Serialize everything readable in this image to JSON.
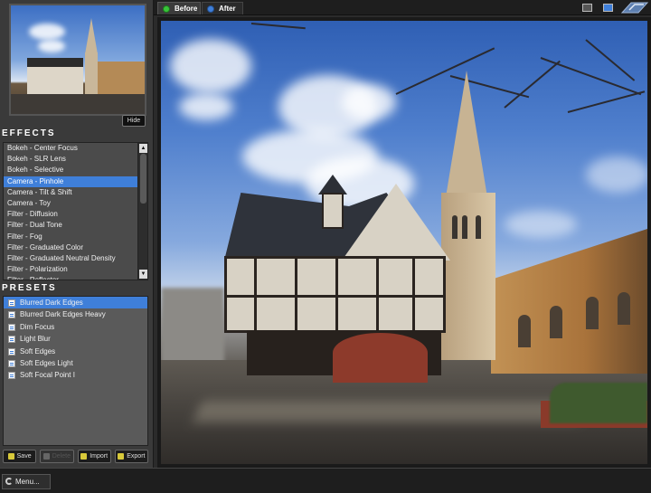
{
  "tabs": [
    {
      "label": "Before"
    },
    {
      "label": "After"
    }
  ],
  "left_panel": {
    "hide_label": "Hide",
    "effects_title": "EFFECTS",
    "effects": [
      "Bokeh - Center Focus",
      "Bokeh - SLR Lens",
      "Bokeh - Selective",
      "Camera - Pinhole",
      "Camera - Tilt & Shift",
      "Camera - Toy",
      "Filter - Diffusion",
      "Filter - Dual Tone",
      "Filter - Fog",
      "Filter - Graduated Color",
      "Filter - Graduated Neutral Density",
      "Filter - Polarization",
      "Filter - Reflector"
    ],
    "selected_effect_index": 3,
    "presets_title": "PRESETS",
    "presets": [
      "Blurred Dark Edges",
      "Blurred Dark Edges Heavy",
      "Dim Focus",
      "Light Blur",
      "Soft Edges",
      "Soft Edges Light",
      "Soft Focal Point I"
    ],
    "selected_preset_index": 0,
    "buttons": {
      "save": "Save",
      "delete": "Delete",
      "import": "Import",
      "export": "Export"
    }
  },
  "bottombar": {
    "menu_label": "Menu..."
  },
  "colors": {
    "selection": "#3f7fd9",
    "before_dot": "#38c43a",
    "after_dot": "#3f7fd9"
  }
}
